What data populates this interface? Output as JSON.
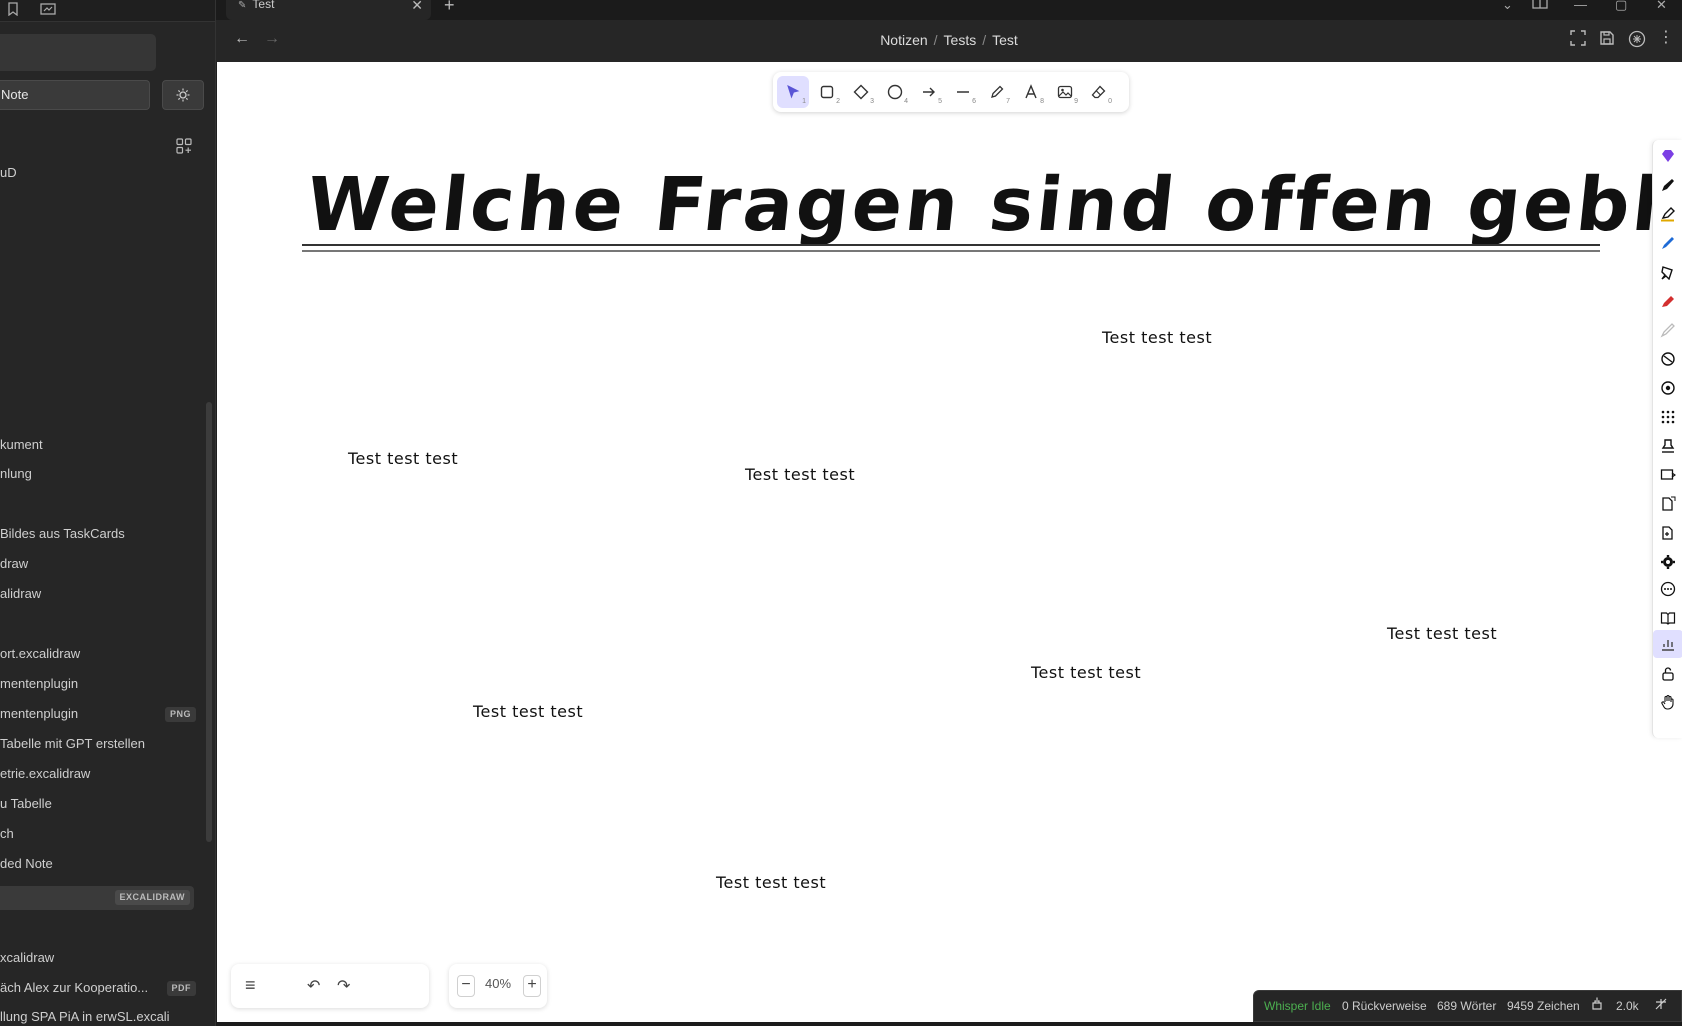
{
  "tab": {
    "title": "Test"
  },
  "breadcrumb": {
    "part1": "Notizen",
    "sep": "/",
    "part2": "Tests",
    "part3": "Test"
  },
  "sidebar": {
    "new_note_label": "Note",
    "files": [
      {
        "label": "uD",
        "badge": ""
      },
      {
        "label": "kument",
        "badge": ""
      },
      {
        "label": "nlung",
        "badge": ""
      },
      {
        "label": "Bildes aus TaskCards",
        "badge": ""
      },
      {
        "label": "draw",
        "badge": ""
      },
      {
        "label": "alidraw",
        "badge": ""
      },
      {
        "label": "ort.excalidraw",
        "badge": ""
      },
      {
        "label": "mentenplugin",
        "badge": ""
      },
      {
        "label": "mentenplugin",
        "badge": "PNG"
      },
      {
        "label": "Tabelle mit GPT erstellen",
        "badge": ""
      },
      {
        "label": "etrie.excalidraw",
        "badge": ""
      },
      {
        "label": "u Tabelle",
        "badge": ""
      },
      {
        "label": "ch",
        "badge": ""
      },
      {
        "label": "ded Note",
        "badge": ""
      },
      {
        "label": "",
        "badge": "EXCALIDRAW"
      },
      {
        "label": "xcalidraw",
        "badge": ""
      },
      {
        "label": "äch Alex zur Kooperatio...",
        "badge": "PDF"
      },
      {
        "label": "llung SPA PiA in erwSL.excali",
        "badge": ""
      }
    ]
  },
  "canvas": {
    "headline": "Welche Fragen sind offen geblieben?",
    "texts": [
      "Test test test",
      "Test test test",
      "Test test test",
      "Test test test",
      "Test test test",
      "Test test test",
      "Test test test"
    ]
  },
  "toolbar": {
    "tools": [
      {
        "name": "selection",
        "key": "1"
      },
      {
        "name": "rectangle",
        "key": "2"
      },
      {
        "name": "diamond",
        "key": "3"
      },
      {
        "name": "ellipse",
        "key": "4"
      },
      {
        "name": "arrow",
        "key": "5"
      },
      {
        "name": "line",
        "key": "6"
      },
      {
        "name": "draw",
        "key": "7"
      },
      {
        "name": "text",
        "key": "8"
      },
      {
        "name": "image",
        "key": "9"
      },
      {
        "name": "eraser",
        "key": "0"
      }
    ]
  },
  "zoom": {
    "value": "40%",
    "minus": "−",
    "plus": "+"
  },
  "status": {
    "whisper": "Whisper Idle",
    "backlinks": "0 Rückverweise",
    "words": "689 Wörter",
    "chars": "9459 Zeichen",
    "count": "2.0k"
  },
  "colors": {
    "accent": "#6965db",
    "whisper": "#4caf50",
    "sidebar_bg": "#262626",
    "canvas_bg": "#ffffff"
  }
}
